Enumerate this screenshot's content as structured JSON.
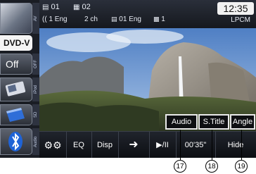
{
  "sidebar": {
    "tabs": [
      "AV",
      "OFF",
      "iPod",
      "SD",
      "Audio"
    ],
    "dvd_label": "DVD-V",
    "off_label": "Off"
  },
  "status": {
    "title_no": "01",
    "chapter_no": "02",
    "audio_track": "1 Eng",
    "channels": "2 ch",
    "subtitle": "01 Eng",
    "angle_no": "1",
    "clock": "12:35",
    "audio_format": "LPCM"
  },
  "overlay": {
    "audio": "Audio",
    "subtitle": "S.Title",
    "angle": "Angle"
  },
  "toolbar": {
    "eq": "EQ",
    "disp": "Disp",
    "play_pause": "▶/II",
    "time": "00'35\"",
    "hide": "Hide"
  },
  "callouts": [
    "17",
    "18",
    "19"
  ]
}
